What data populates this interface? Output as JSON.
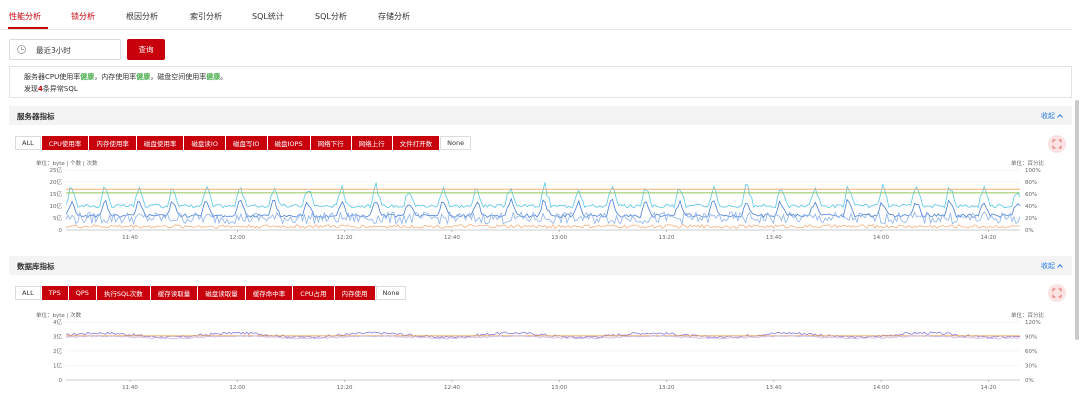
{
  "tabs": [
    {
      "label": "性能分析",
      "active": true
    },
    {
      "label": "锁分析",
      "active": true
    },
    {
      "label": "根因分析",
      "active": false
    },
    {
      "label": "索引分析",
      "active": false
    },
    {
      "label": "SQL统计",
      "active": false
    },
    {
      "label": "SQL分析",
      "active": false
    },
    {
      "label": "存储分析",
      "active": false
    }
  ],
  "toolbar": {
    "time_range": "最近3小时",
    "query_label": "查询"
  },
  "summary": {
    "l1_a": "服务器CPU使用率",
    "l1_b": "健康",
    "l1_c": "，内存使用率",
    "l1_d": "健康",
    "l1_e": "，磁盘空间使用率",
    "l1_f": "健康",
    "l1_g": "。",
    "l2_a": "发现",
    "l2_b": "4",
    "l2_c": "条异常SQL"
  },
  "server_section": {
    "title": "服务器指标",
    "collapse": "收起",
    "chips": [
      {
        "label": "ALL",
        "on": false
      },
      {
        "label": "CPU使用率",
        "on": true
      },
      {
        "label": "内存使用率",
        "on": true
      },
      {
        "label": "磁盘使用率",
        "on": true
      },
      {
        "label": "磁盘读IO",
        "on": true
      },
      {
        "label": "磁盘写IO",
        "on": true
      },
      {
        "label": "磁盘IOPS",
        "on": true
      },
      {
        "label": "网络下行",
        "on": true
      },
      {
        "label": "网络上行",
        "on": true
      },
      {
        "label": "文件打开数",
        "on": true
      },
      {
        "label": "None",
        "on": false
      }
    ],
    "unit_left": "单位：byte | 个数 | 次数",
    "unit_right": "单位：百分比"
  },
  "db_section": {
    "title": "数据库指标",
    "collapse": "收起",
    "chips": [
      {
        "label": "ALL",
        "on": false
      },
      {
        "label": "TPS",
        "on": true
      },
      {
        "label": "QPS",
        "on": true
      },
      {
        "label": "执行SQL次数",
        "on": true
      },
      {
        "label": "缓存读取量",
        "on": true
      },
      {
        "label": "磁盘读取量",
        "on": true
      },
      {
        "label": "缓存命中率",
        "on": true
      },
      {
        "label": "CPU占用",
        "on": true
      },
      {
        "label": "内存使用",
        "on": true
      },
      {
        "label": "None",
        "on": false
      }
    ],
    "unit_left": "单位：byte | 次数",
    "unit_right": "单位：百分比"
  },
  "chart_data": [
    {
      "type": "line",
      "x_ticks": [
        "11:40",
        "12:00",
        "12:20",
        "12:40",
        "13:00",
        "13:20",
        "13:40",
        "14:00",
        "14:20"
      ],
      "y_left_ticks": [
        "25亿",
        "20亿",
        "15亿",
        "10亿",
        "5亿",
        "0"
      ],
      "y_right_ticks": [
        "100%",
        "80%",
        "60%",
        "40%",
        "20%",
        "0%"
      ],
      "ylim_left": [
        0,
        25
      ],
      "series": [
        {
          "color": "#5bc8e8",
          "shape": "spiky",
          "base": 10,
          "amp": 11
        },
        {
          "color": "#4a7fd4",
          "shape": "spiky",
          "base": 6,
          "amp": 8
        },
        {
          "color": "#8fb3ea",
          "shape": "noisy",
          "base": 4,
          "amp": 5
        },
        {
          "color": "#f0a25a",
          "shape": "flat",
          "level": 17
        },
        {
          "color": "#8bc34a",
          "shape": "flat",
          "level": 15.5
        },
        {
          "color": "#f4b183",
          "shape": "noisy",
          "base": 1.2,
          "amp": 1.5
        }
      ]
    },
    {
      "type": "line",
      "x_ticks": [
        "11:40",
        "12:00",
        "12:20",
        "12:40",
        "13:00",
        "13:20",
        "13:40",
        "14:00",
        "14:20"
      ],
      "y_left_ticks": [
        "4亿",
        "3亿",
        "2亿",
        "1亿",
        "0"
      ],
      "y_right_ticks": [
        "120%",
        "90%",
        "60%",
        "30%",
        "0%"
      ],
      "ylim_left": [
        0,
        4
      ],
      "series": [
        {
          "color": "#8d7ad8",
          "shape": "wavy",
          "base": 3.1,
          "amp": 0.35
        },
        {
          "color": "#f0a25a",
          "shape": "flat",
          "level": 3.05
        },
        {
          "color": "#c7b8ec",
          "shape": "wavy",
          "base": 2.95,
          "amp": 0.2
        }
      ]
    }
  ]
}
